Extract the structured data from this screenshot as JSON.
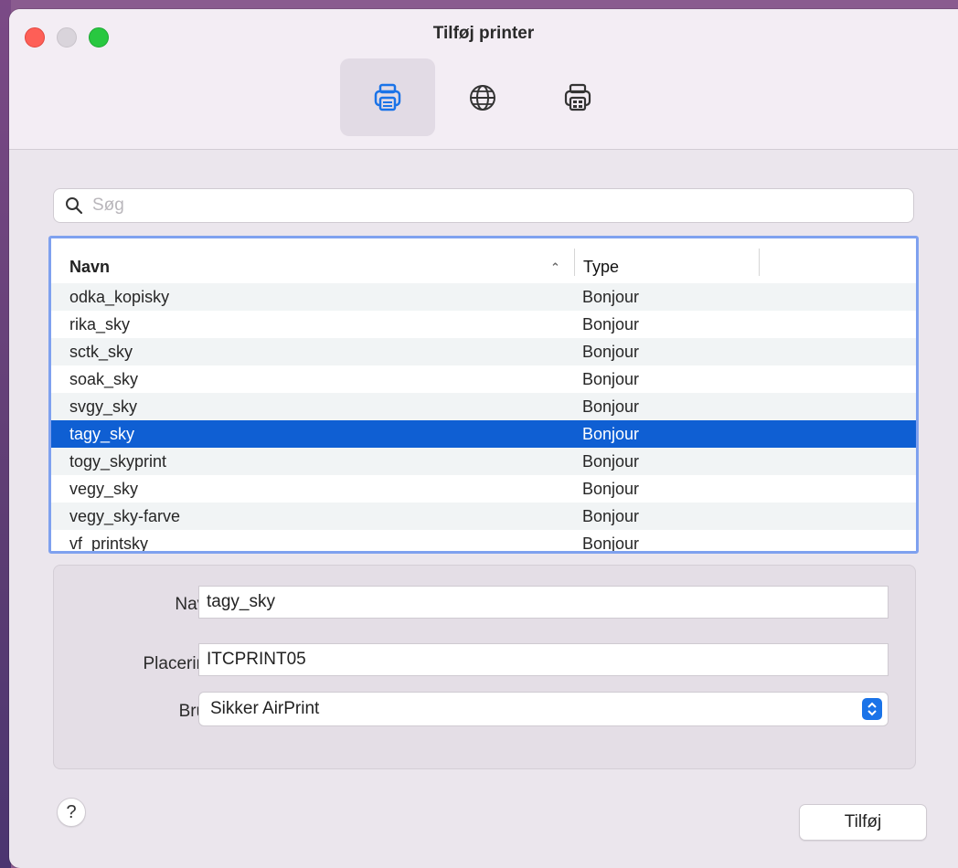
{
  "window": {
    "title": "Tilføj printer"
  },
  "toolbar": {
    "tabs": [
      {
        "icon": "printer-icon",
        "selected": true
      },
      {
        "icon": "globe-icon",
        "selected": false
      },
      {
        "icon": "windows-printer-icon",
        "selected": false
      }
    ]
  },
  "search": {
    "placeholder": "Søg",
    "value": ""
  },
  "list": {
    "columns": {
      "name": "Navn",
      "type": "Type"
    },
    "rows": [
      {
        "name": "odka_kopisky",
        "type": "Bonjour"
      },
      {
        "name": "rika_sky",
        "type": "Bonjour"
      },
      {
        "name": "sctk_sky",
        "type": "Bonjour"
      },
      {
        "name": "soak_sky",
        "type": "Bonjour"
      },
      {
        "name": "svgy_sky",
        "type": "Bonjour"
      },
      {
        "name": "tagy_sky",
        "type": "Bonjour"
      },
      {
        "name": "togy_skyprint",
        "type": "Bonjour"
      },
      {
        "name": "vegy_sky",
        "type": "Bonjour"
      },
      {
        "name": "vegy_sky-farve",
        "type": "Bonjour"
      },
      {
        "name": "vf_printsky",
        "type": "Bonjour"
      }
    ],
    "selected_index": 5
  },
  "details": {
    "name_label": "Navn:",
    "name_value": "tagy_sky",
    "location_label": "Placering:",
    "location_value": "ITCPRINT05",
    "use_label": "Brug:",
    "use_value": "Sikker AirPrint"
  },
  "footer": {
    "help_label": "?",
    "add_label": "Tilføj"
  },
  "colors": {
    "selection": "#0f5fd3",
    "focus_ring": "#7fa1ef",
    "accent": "#1a73e8"
  }
}
